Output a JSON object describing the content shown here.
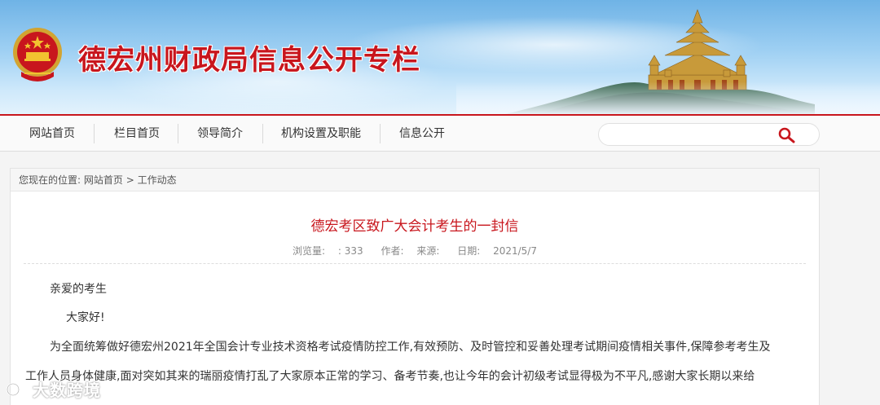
{
  "header": {
    "site_title": "德宏州财政局信息公开专栏"
  },
  "nav": {
    "items": [
      {
        "label": "网站首页"
      },
      {
        "label": "栏目首页"
      },
      {
        "label": "领导简介"
      },
      {
        "label": "机构设置及职能"
      },
      {
        "label": "信息公开"
      }
    ],
    "search": {
      "placeholder": "",
      "value": ""
    }
  },
  "breadcrumb": {
    "prefix": "您现在的位置:",
    "home": "网站首页",
    "separator": ">",
    "current": "工作动态"
  },
  "article": {
    "title": "德宏考区致广大会计考生的一封信",
    "views_label": "浏览量:",
    "views_value": ": 333",
    "author_label": "作者:",
    "source_label": "来源:",
    "date_label": "日期:",
    "date_value": "2021/5/7",
    "salutation": "亲爱的考生",
    "greeting": "大家好!",
    "para1_line1": "为全面统筹做好德宏州2021年全国会计专业技术资格考试疫情防控工作,有效预防、及时管控和妥善处理考试期间疫情相关事件,保障参考考生及",
    "para1_line2": "工作人员身体健康,面对突如其来的瑞丽疫情打乱了大家原本正常的学习、备考节奏,也让今年的会计初级考试显得极为不平凡,感谢大家长期以来给"
  },
  "watermark": {
    "text": "大数跨境"
  },
  "colors": {
    "brand_red": "#c8161d"
  }
}
